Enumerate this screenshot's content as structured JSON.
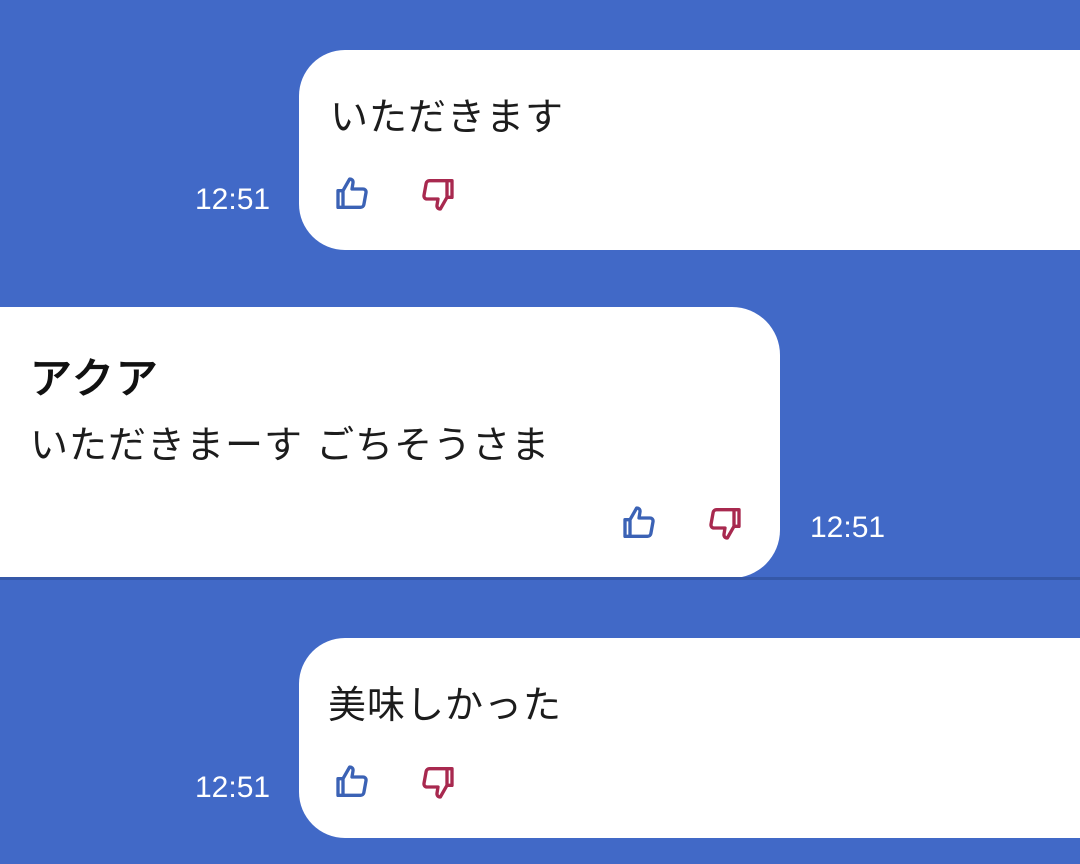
{
  "colors": {
    "background": "#4169c7",
    "bubble": "#ffffff",
    "like": "#3b62b5",
    "dislike": "#a8294f"
  },
  "messages": [
    {
      "direction": "outgoing",
      "text": "いただきます",
      "time": "12:51",
      "reactions": [
        "thumbs-up-icon",
        "thumbs-down-icon"
      ]
    },
    {
      "direction": "incoming",
      "sender": "アクア",
      "text": "いただきまーす ごちそうさま",
      "time": "12:51",
      "reactions": [
        "thumbs-up-icon",
        "thumbs-down-icon"
      ]
    },
    {
      "direction": "outgoing",
      "text": "美味しかった",
      "time": "12:51",
      "reactions": [
        "thumbs-up-icon",
        "thumbs-down-icon"
      ]
    }
  ]
}
